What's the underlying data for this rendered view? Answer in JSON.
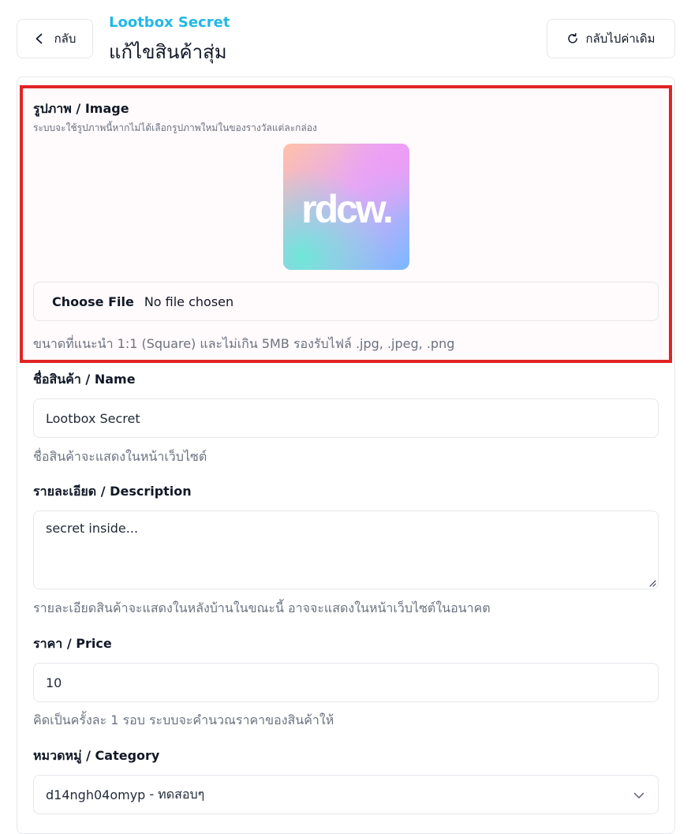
{
  "header": {
    "back_label": "กลับ",
    "subtitle": "Lootbox Secret",
    "title": "แก้ไขสินค้าสุ่ม",
    "reset_label": "กลับไปค่าเดิม"
  },
  "image_section": {
    "label": "รูปภาพ / Image",
    "description": "ระบบจะใช้รูปภาพนี้หากไม่ได้เลือกรูปภาพใหม่ในของรางวัลแต่ละกล่อง",
    "preview_text": "rdcw.",
    "choose_file_label": "Choose File",
    "no_file_label": "No file chosen",
    "hint": "ขนาดที่แนะนำ 1:1 (Square) และไม่เกิน 5MB รองรับไฟล์ .jpg, .jpeg, .png"
  },
  "name_section": {
    "label": "ชื่อสินค้า / Name",
    "value": "Lootbox Secret",
    "hint": "ชื่อสินค้าจะแสดงในหน้าเว็บไซต์"
  },
  "description_section": {
    "label": "รายละเอียด / Description",
    "value": "secret inside...",
    "hint": "รายละเอียดสินค้าจะแสดงในหลังบ้านในขณะนี้ อาจจะแสดงในหน้าเว็บไซต์ในอนาคต"
  },
  "price_section": {
    "label": "ราคา / Price",
    "value": "10",
    "hint": "คิดเป็นครั้งละ 1 รอบ ระบบจะคำนวณราคาของสินค้าให้"
  },
  "category_section": {
    "label": "หมวดหมู่ / Category",
    "selected_code": "d14ngh04omyp",
    "selected_name": "- ทดสอบๆ"
  },
  "colors": {
    "accent": "#22b8e6",
    "highlight_border": "#e02424"
  }
}
